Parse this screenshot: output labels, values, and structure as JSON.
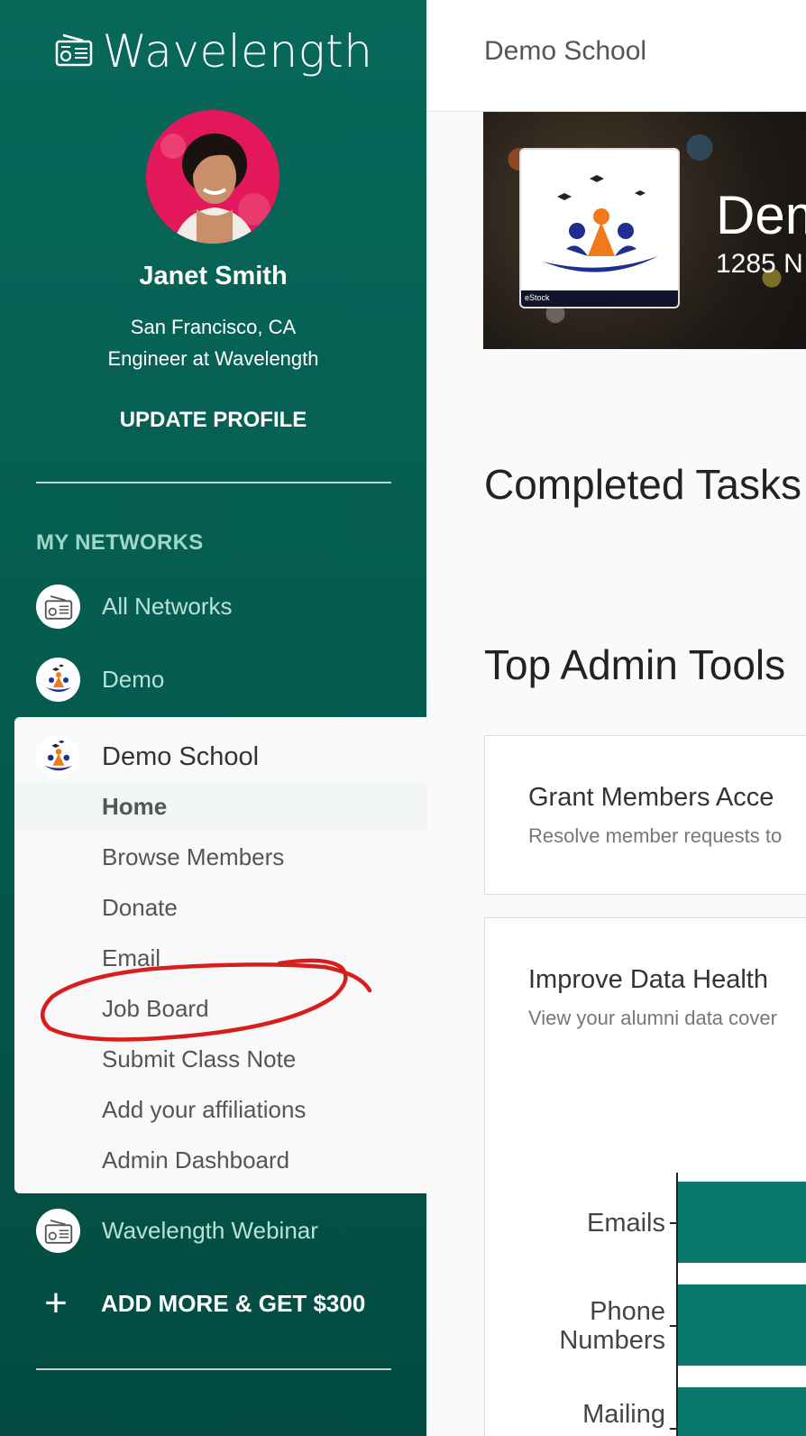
{
  "app": {
    "brand": "Wavelength",
    "brand_icon": "radio-icon",
    "accent": "#07685a"
  },
  "profile": {
    "name": "Janet Smith",
    "location": "San Francisco, CA",
    "title": "Engineer at Wavelength",
    "update_label": "UPDATE PROFILE"
  },
  "networks": {
    "section_label": "MY NETWORKS",
    "items": [
      {
        "label": "All Networks",
        "icon": "radio-icon"
      },
      {
        "label": "Demo",
        "icon": "school-logo-icon"
      }
    ],
    "active": {
      "label": "Demo School",
      "icon": "school-logo-icon",
      "sub_items": [
        {
          "label": "Home",
          "active": true
        },
        {
          "label": "Browse Members"
        },
        {
          "label": "Donate"
        },
        {
          "label": "Email"
        },
        {
          "label": "Job Board"
        },
        {
          "label": "Submit Class Note"
        },
        {
          "label": "Add your affiliations"
        },
        {
          "label": "Admin Dashboard"
        }
      ]
    },
    "after_items": [
      {
        "label": "Wavelength Webinar",
        "icon": "radio-icon"
      }
    ],
    "add_more_label": "ADD MORE & GET $300"
  },
  "main": {
    "topbar_title": "Demo School",
    "banner": {
      "title": "Dem",
      "subtitle": "1285 N",
      "logo_strip_text": "eStock"
    },
    "completed_title": "Completed Tasks",
    "admin_tools_title": "Top Admin Tools",
    "tools": [
      {
        "title": "Grant Members Acce",
        "desc": "Resolve member requests to"
      },
      {
        "title": "Improve Data Health",
        "desc": "View your alumni data cover"
      }
    ]
  },
  "chart_data": {
    "type": "bar",
    "orientation": "horizontal",
    "categories": [
      "Emails",
      "Phone Numbers",
      "Mailing"
    ],
    "color": "#08786a"
  }
}
